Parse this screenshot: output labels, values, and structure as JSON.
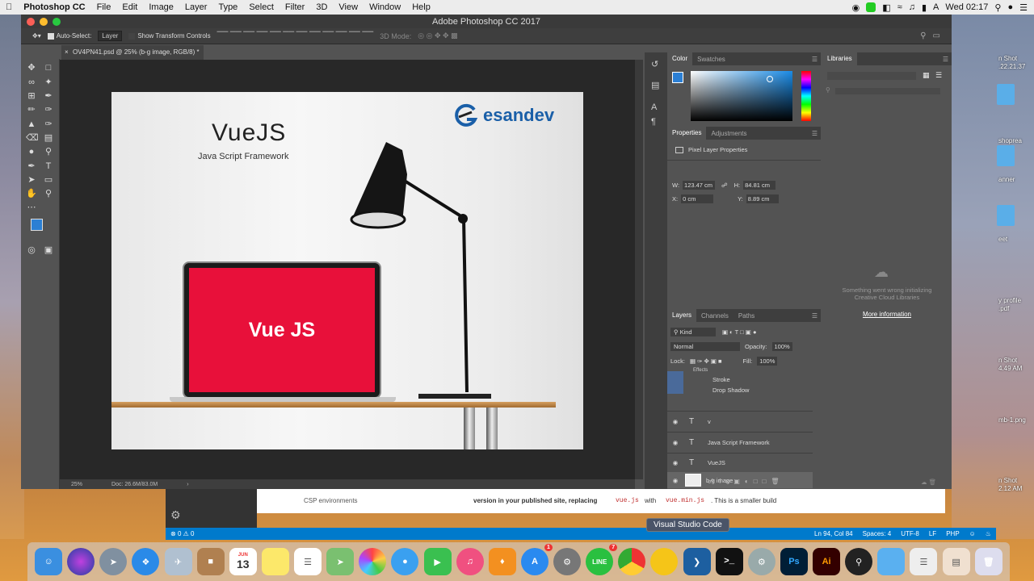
{
  "menubar": {
    "app": "Photoshop CC",
    "items": [
      "File",
      "Edit",
      "Image",
      "Layer",
      "Type",
      "Select",
      "Filter",
      "3D",
      "View",
      "Window",
      "Help"
    ],
    "clock": "Wed 02:17"
  },
  "window": {
    "title": "Adobe Photoshop CC 2017",
    "doc_tab": "OV4PN41.psd @ 25% (b-g image, RGB/8) *"
  },
  "options": {
    "auto_select_label": "Auto-Select:",
    "auto_select_value": "Layer",
    "show_transform_label": "Show Transform Controls",
    "mode_3d": "3D Mode:"
  },
  "canvas": {
    "title": "VueJS",
    "subtitle": "Java Script Framework",
    "brand": "esandev",
    "screen_text": "Vue JS",
    "screen_color": "#e8103a",
    "brand_color": "#1a5fa8"
  },
  "status": {
    "zoom": "25%",
    "doc": "Doc: 26.6M/83.0M"
  },
  "color_panel": {
    "tabs": [
      "Color",
      "Swatches"
    ],
    "fg": "#2b7fd4"
  },
  "properties": {
    "tabs": [
      "Properties",
      "Adjustments"
    ],
    "heading": "Pixel Layer Properties",
    "w_label": "W:",
    "w": "123.47 cm",
    "h_label": "H:",
    "h": "84.81 cm",
    "x_label": "X:",
    "x": "0 cm",
    "y_label": "Y:",
    "y": "8.89 cm"
  },
  "libraries": {
    "tab": "Libraries",
    "error": "Something went wrong initializing Creative Cloud Libraries",
    "more": "More information"
  },
  "layers": {
    "tabs": [
      "Layers",
      "Channels",
      "Paths"
    ],
    "kind": "Kind",
    "blend": "Normal",
    "opacity_label": "Opacity:",
    "opacity": "100%",
    "lock_label": "Lock:",
    "fill_label": "Fill:",
    "fill": "100%",
    "effects": "Effects",
    "effect_items": [
      "Stroke",
      "Drop Shadow"
    ],
    "rows": [
      {
        "name": "v",
        "type": "T"
      },
      {
        "name": "Java Script Framework",
        "type": "T"
      },
      {
        "name": "VueJS",
        "type": "T"
      },
      {
        "name": "b-g image",
        "type": "img"
      }
    ]
  },
  "vscode": {
    "left_item": "CSP environments",
    "doc_line1": "version in your published site, replacing",
    "code1": "vue.js",
    "with": "with",
    "code2": "vue.min.js",
    "doc_tail": ". This is a smaller build",
    "status_left": "0 ⚠ 0",
    "status_right": [
      "Ln 94, Col 84",
      "Spaces: 4",
      "UTF-8",
      "LF",
      "PHP"
    ],
    "tooltip": "Visual Studio Code"
  },
  "desktop": {
    "labels": [
      "n Shot",
      ".22.21.37",
      "shoprea",
      "anner",
      "eet",
      "y profile",
      ".pdf",
      "n Shot",
      "4.49 AM",
      "mb-1.png",
      "n Shot",
      "2.12 AM"
    ]
  },
  "dock": {
    "calendar_day": "13",
    "calendar_month": "JUN",
    "line_badge": "7",
    "appstore_badge": "1",
    "ps_label": "Ps",
    "ai_label": "Ai"
  }
}
